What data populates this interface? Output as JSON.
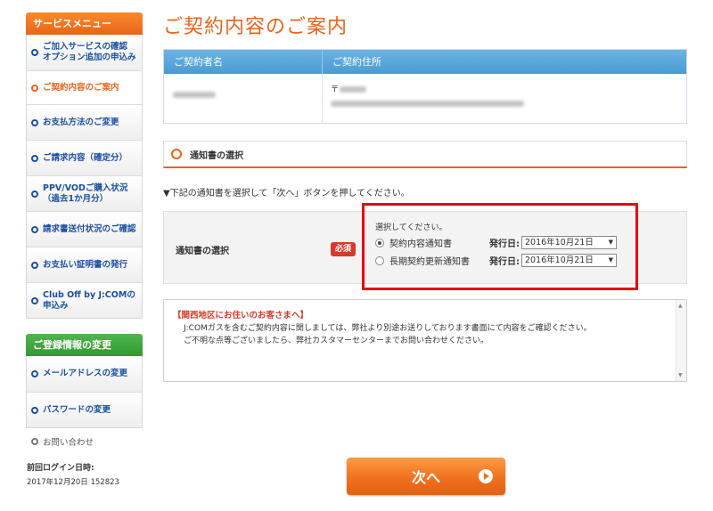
{
  "sidebar": {
    "service_menu_title": "サービスメニュー",
    "items": [
      {
        "label": "ご加入サービスの確認\nオプション追加の申込み"
      },
      {
        "label": "ご契約内容のご案内"
      },
      {
        "label": "お支払方法のご変更"
      },
      {
        "label": "ご請求内容（確定分）"
      },
      {
        "label": "PPV/VODご購入状況\n（過去1か月分）"
      },
      {
        "label": "請求書送付状況のご確認"
      },
      {
        "label": "お支払い証明書の発行"
      },
      {
        "label": "Club Off by J:COMの\n申込み"
      }
    ],
    "registration_title": "ご登録情報の変更",
    "registration_items": [
      {
        "label": "メールアドレスの変更"
      },
      {
        "label": "パスワードの変更"
      }
    ],
    "contact_label": "お問い合わせ",
    "last_login_label": "前回ログイン日時:",
    "last_login_value": "2017年12月20日 152823"
  },
  "main": {
    "page_title": "ご契約内容のご案内",
    "table": {
      "col1_header": "ご契約者名",
      "col2_header": "ご契約住所",
      "postal_prefix": "〒"
    },
    "section_title": "通知書の選択",
    "instruction": "▼下記の通知書を選択して「次へ」ボタンを押してください。",
    "select_label": "通知書の選択",
    "required_badge": "必須",
    "prompt": "選択してください。",
    "options": [
      {
        "label": "契約内容通知書",
        "issue_label": "発行日:",
        "date": "2016年10月21日",
        "selected": true
      },
      {
        "label": "長期契約更新通知書",
        "issue_label": "発行日:",
        "date": "2016年10月21日",
        "selected": false
      }
    ],
    "notice": {
      "title": "【関西地区にお住いのお客さまへ】",
      "line1": "J:COMガスを含むご契約内容に関しましては、弊社より別途お送りしております書面にて内容をご確認ください。",
      "line2": "ご不明な点等ございましたら、弊社カスタマーセンターまでお問い合わせください。"
    },
    "next_button": "次へ"
  },
  "colors": {
    "accent_orange": "#e8641a",
    "link_blue": "#1b4fa0",
    "table_header_blue": "#4a9bd3",
    "required_red": "#d9392b",
    "highlight_red": "#e60012",
    "registration_green": "#2f9a30"
  }
}
